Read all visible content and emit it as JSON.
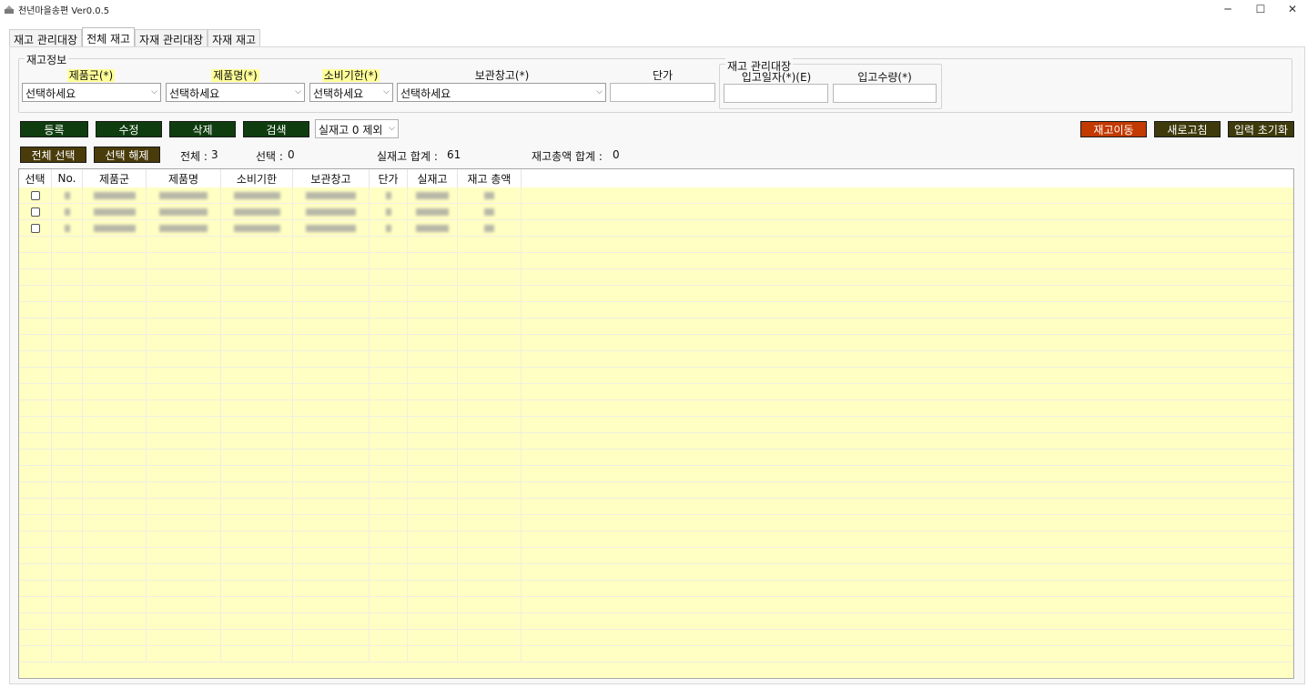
{
  "window": {
    "title": "천년마을송편 Ver0.0.5",
    "minimize": "─",
    "maximize": "☐",
    "close": "✕"
  },
  "tabs": [
    {
      "label": "재고 관리대장",
      "active": false
    },
    {
      "label": "전체 재고",
      "active": true
    },
    {
      "label": "자재 관리대장",
      "active": false
    },
    {
      "label": "자재 재고",
      "active": false
    }
  ],
  "stock_info": {
    "group_label": "재고정보",
    "product_group_label": "제품군(*)",
    "product_group_value": "선택하세요",
    "product_name_label": "제품명(*)",
    "product_name_value": "선택하세요",
    "expiry_label": "소비기한(*)",
    "expiry_value": "선택하세요",
    "warehouse_label": "보관창고(*)",
    "warehouse_value": "선택하세요",
    "unit_price_label": "단가"
  },
  "ledger_group": {
    "group_label": "재고 관리대장",
    "receipt_date_label": "입고일자(*)(E)",
    "receipt_qty_label": "입고수량(*)"
  },
  "actions": {
    "register": "등록",
    "edit": "수정",
    "delete": "삭제",
    "search": "검색",
    "filter_value": "실재고 0 제외",
    "move_stock": "재고이동",
    "refresh": "새로고침",
    "reset_input": "입력 초기화",
    "select_all": "전체 선택",
    "deselect": "선택 해제"
  },
  "stats": {
    "total_label": "전체 :",
    "total_value": "3",
    "selected_label": "선택 :",
    "selected_value": "0",
    "actual_sum_label": "실재고 합계 :",
    "actual_sum_value": "61",
    "amount_sum_label": "재고총액 합계 :",
    "amount_sum_value": "0"
  },
  "grid": {
    "columns": [
      "선택",
      "No.",
      "제품군",
      "제품명",
      "소비기한",
      "보관창고",
      "단가",
      "실재고",
      "재고 총액"
    ]
  },
  "colors": {
    "grid_bg": "#ffffc4",
    "green_button": "#0f3d0f",
    "olive_button": "#4a3c0a",
    "orange_button": "#c23a00",
    "label_highlight": "#ffff99"
  }
}
